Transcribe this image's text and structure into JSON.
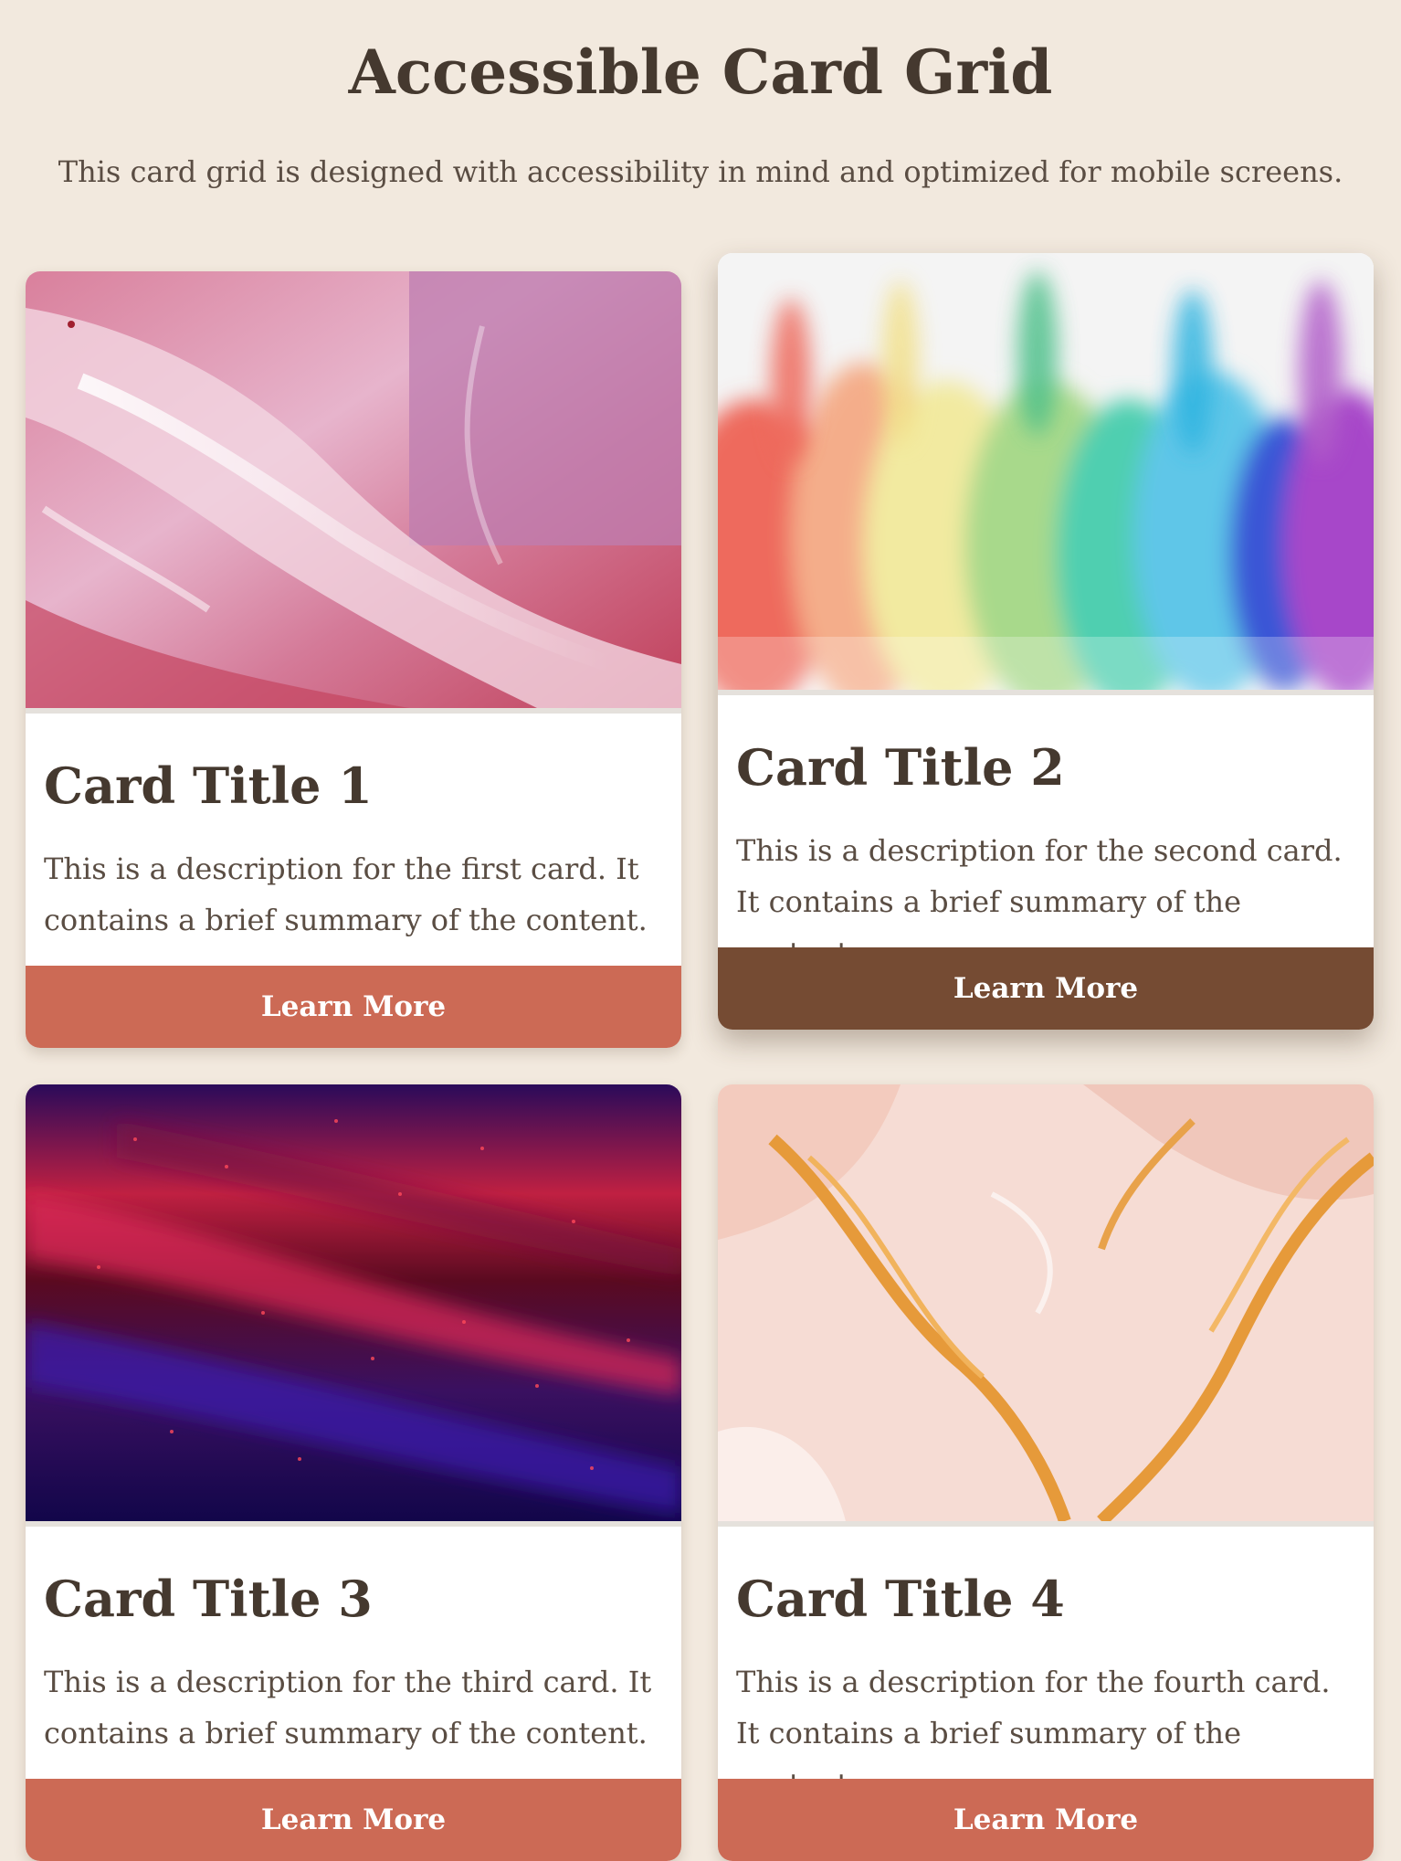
{
  "page": {
    "title": "Accessible Card Grid",
    "subtitle": "This card grid is designed with accessibility in mind and optimized for mobile screens."
  },
  "colors": {
    "background": "#f2e9de",
    "text": "#45392f",
    "button": "#cc6a55",
    "button_active": "#754b33"
  },
  "cards": [
    {
      "image_name": "pink-fluid-abstract-image",
      "title": "Card Title 1",
      "description": "This is a description for the first card. It contains a brief summary of the content.",
      "button_label": "Learn More"
    },
    {
      "image_name": "rainbow-ink-clouds-image",
      "title": "Card Title 2",
      "description": "This is a description for the second card. It contains a brief summary of the content.",
      "button_label": "Learn More"
    },
    {
      "image_name": "red-purple-paint-streaks-image",
      "title": "Card Title 3",
      "description": "This is a description for the third card. It contains a brief summary of the content.",
      "button_label": "Learn More"
    },
    {
      "image_name": "peach-orange-marble-image",
      "title": "Card Title 4",
      "description": "This is a description for the fourth card. It contains a brief summary of the content.",
      "button_label": "Learn More"
    }
  ]
}
